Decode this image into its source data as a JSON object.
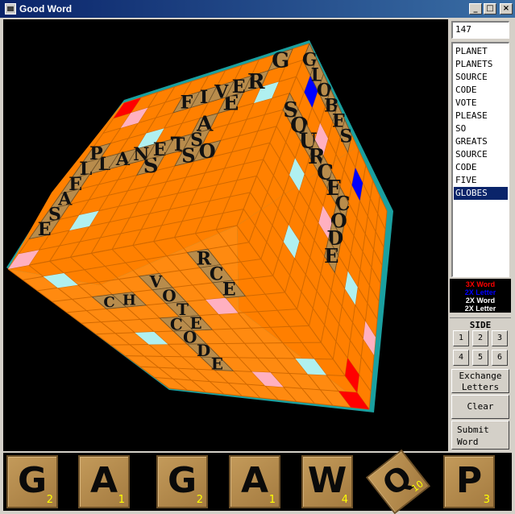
{
  "window": {
    "title": "Good Word",
    "minimize_label": "_",
    "maximize_label": "□",
    "close_label": "×"
  },
  "score": "147",
  "words": [
    "PLANET",
    "PLANETS",
    "SOURCE",
    "CODE",
    "VOTE",
    "PLEASE",
    "SO",
    "GREATS",
    "SOURCE",
    "CODE",
    "FIVE",
    "GLOBES"
  ],
  "selected_word_index": 11,
  "legend": [
    {
      "label": "3X Word",
      "color": "#ff0000"
    },
    {
      "label": "2X Letter",
      "color": "#0000ff"
    },
    {
      "label": "2X Word",
      "color": "#ffffff"
    },
    {
      "label": "2X Letter",
      "color": "#ffffff"
    }
  ],
  "side": {
    "label": "SIDE",
    "buttons": [
      "1",
      "2",
      "3",
      "4",
      "5",
      "6"
    ]
  },
  "buttons": {
    "exchange_line1": "Exchange",
    "exchange_line2": "Letters",
    "clear": "Clear",
    "submit_line1": "Submit",
    "submit_line2": "Word"
  },
  "rack": [
    {
      "letter": "G",
      "score": "2"
    },
    {
      "letter": "A",
      "score": "1"
    },
    {
      "letter": "G",
      "score": "2"
    },
    {
      "letter": "A",
      "score": "1"
    },
    {
      "letter": "W",
      "score": "4"
    },
    {
      "letter": "Q",
      "score": "10"
    },
    {
      "letter": "P",
      "score": "3"
    }
  ],
  "colors": {
    "cube_face": "#ff8000",
    "cube_edge": "#1aa0a0",
    "tile": "#b88c4c",
    "triple_word": "#ff0000",
    "double_letter": "#0000ff",
    "double_word": "#ffb0c0",
    "double_letter_light": "#b0f0f0"
  },
  "cube_words": {
    "top_diag": [
      "G",
      "R",
      "E",
      "A",
      "T",
      "S"
    ],
    "top_five": [
      "F",
      "I",
      "V",
      "E"
    ],
    "top_planets": [
      "P",
      "L",
      "A",
      "N",
      "E",
      "T",
      "S"
    ],
    "top_so": [
      "S",
      "O"
    ],
    "right_globes": [
      "G",
      "L",
      "O",
      "B",
      "E",
      "S"
    ],
    "right_source": [
      "S",
      "O",
      "U",
      "R",
      "C",
      "E"
    ],
    "right_code": [
      "C",
      "O",
      "D",
      "E"
    ],
    "left_please": [
      "P",
      "L",
      "E",
      "A",
      "S",
      "E"
    ],
    "bottom_vote": [
      "V",
      "O",
      "T",
      "E"
    ],
    "bottom_code": [
      "C",
      "O",
      "D",
      "E"
    ],
    "bottom_source_tail": [
      "R",
      "C",
      "E"
    ],
    "bottom_ch": [
      "C",
      "H"
    ]
  }
}
